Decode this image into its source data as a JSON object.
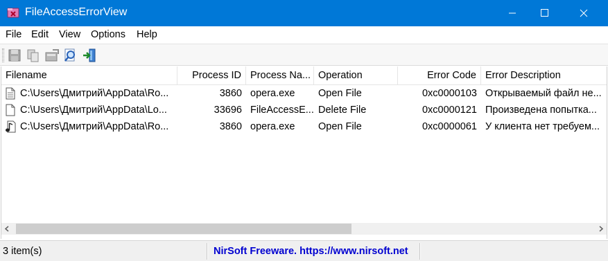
{
  "window": {
    "title": "FileAccessErrorView",
    "icon": "app-icon",
    "controls": [
      "minimize-icon",
      "maximize-icon",
      "close-icon"
    ]
  },
  "menu": {
    "file": "File",
    "edit": "Edit",
    "view": "View",
    "options": "Options",
    "help": "Help"
  },
  "toolbar": {
    "buttons": [
      "save-icon",
      "copy-icon",
      "properties-icon",
      "find-icon",
      "exit-icon"
    ]
  },
  "table": {
    "columns": {
      "filename": "Filename",
      "process_id": "Process ID",
      "process_name": "Process Na...",
      "operation": "Operation",
      "error_code": "Error Code",
      "error_description": "Error Description"
    },
    "rows": [
      {
        "icon": "document-icon",
        "filename": "C:\\Users\\Дмитрий\\AppData\\Ro...",
        "process_id": "3860",
        "process_name": "opera.exe",
        "operation": "Open File",
        "error_code": "0xc0000103",
        "error_description": "Открываемый файл не..."
      },
      {
        "icon": "blank-file-icon",
        "filename": "C:\\Users\\Дмитрий\\AppData\\Lo...",
        "process_id": "33696",
        "process_name": "FileAccessE...",
        "operation": "Delete File",
        "error_code": "0xc0000121",
        "error_description": "Произведена попытка..."
      },
      {
        "icon": "music-file-icon",
        "filename": "C:\\Users\\Дмитрий\\AppData\\Ro...",
        "process_id": "3860",
        "process_name": "opera.exe",
        "operation": "Open File",
        "error_code": "0xc0000061",
        "error_description": "У клиента нет требуем..."
      }
    ]
  },
  "statusbar": {
    "count": "3 item(s)",
    "credit": "NirSoft Freeware. https://www.nirsoft.net"
  },
  "colors": {
    "titlebar": "#0078d7",
    "link": "#0000d0"
  }
}
